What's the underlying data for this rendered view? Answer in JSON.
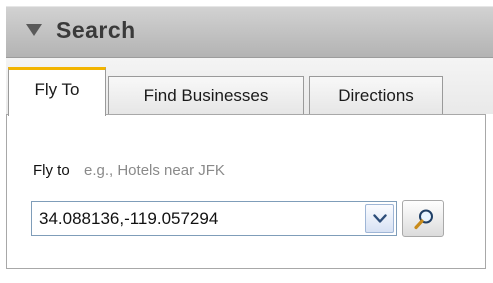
{
  "header": {
    "title": "Search",
    "collapse_icon": "triangle-down-icon"
  },
  "tabs": [
    {
      "label": "Fly To",
      "active": true
    },
    {
      "label": "Find Businesses",
      "active": false
    },
    {
      "label": "Directions",
      "active": false
    }
  ],
  "fly_to": {
    "label": "Fly to",
    "hint": "e.g., Hotels near JFK",
    "input_value": "34.088136,-119.057294",
    "dropdown_icon": "chevron-down-icon",
    "search_icon": "magnifier-icon"
  },
  "colors": {
    "active_tab_accent": "#f2b400",
    "header_bg": "#c4c4c4"
  }
}
